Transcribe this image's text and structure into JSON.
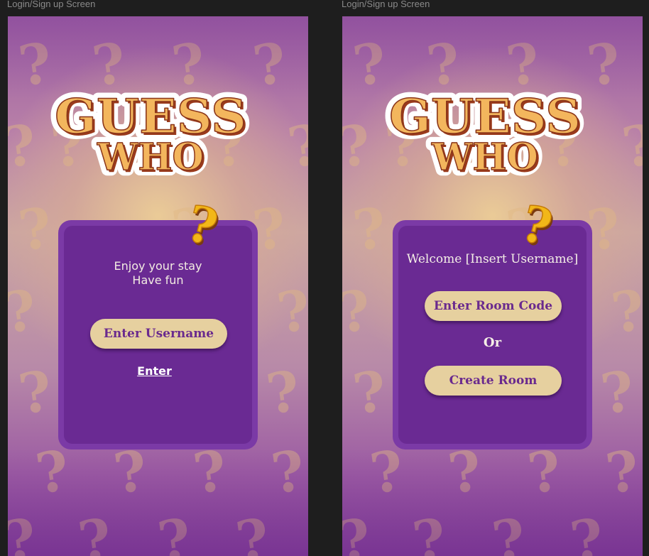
{
  "frames": [
    {
      "label": "Login/Sign up Screen",
      "logo": {
        "line1": "GUESS",
        "line2": "WHO"
      },
      "card": {
        "tagline_line1": "Enjoy your stay",
        "tagline_line2": "Have fun",
        "username_button": "Enter Username",
        "enter_link": "Enter"
      }
    },
    {
      "label": "Login/Sign up Screen",
      "logo": {
        "line1": "GUESS",
        "line2": "WHO"
      },
      "card": {
        "welcome": "Welcome [Insert Username]",
        "room_code_button": "Enter Room Code",
        "or_text": "Or",
        "create_room_button": "Create Room"
      }
    }
  ],
  "colors": {
    "canvas": "#1e1e1e",
    "card_outer": "#7b3aa6",
    "card_inner": "#6a2a93",
    "button_fill": "#e6d09f",
    "button_text": "#6a2a8e",
    "logo_fill": "#f2b55c",
    "logo_shadow": "#b3471f"
  },
  "icons": [
    "question-mark-pattern",
    "question-mark-icon"
  ]
}
